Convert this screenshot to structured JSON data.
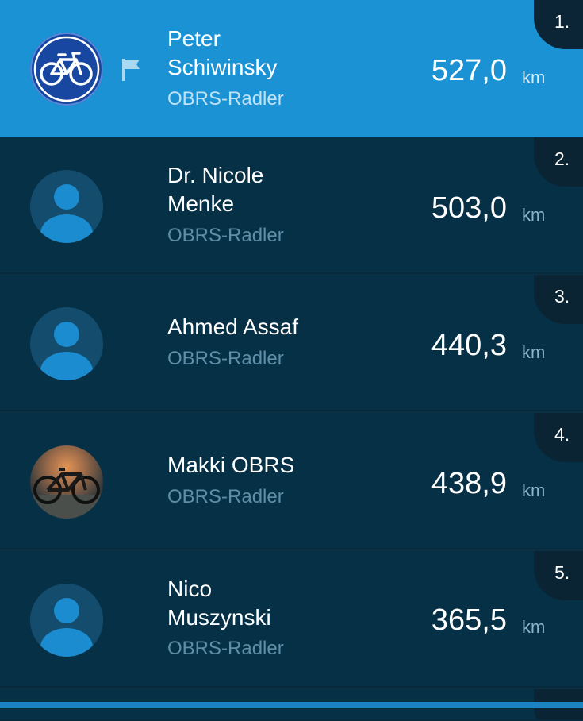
{
  "unit": "km",
  "colors": {
    "highlight": "#1a92d3",
    "row_background": "#063046",
    "avatar_accent": "#1b8cd0"
  },
  "entries": [
    {
      "rank": "1.",
      "name": "Peter\nSchiwinsky",
      "team": "OBRS-Radler",
      "distance": "527,0",
      "avatar": "bicycle-logo",
      "flag": "flag-icon",
      "highlighted": true
    },
    {
      "rank": "2.",
      "name": "Dr. Nicole\nMenke",
      "team": "OBRS-Radler",
      "distance": "503,0",
      "avatar": "person-placeholder"
    },
    {
      "rank": "3.",
      "name": "Ahmed Assaf",
      "team": "OBRS-Radler",
      "distance": "440,3",
      "avatar": "person-placeholder"
    },
    {
      "rank": "4.",
      "name": "Makki OBRS",
      "team": "OBRS-Radler",
      "distance": "438,9",
      "avatar": "bike-photo"
    },
    {
      "rank": "5.",
      "name": "Nico\nMuszynski",
      "team": "OBRS-Radler",
      "distance": "365,5",
      "avatar": "person-placeholder"
    }
  ]
}
